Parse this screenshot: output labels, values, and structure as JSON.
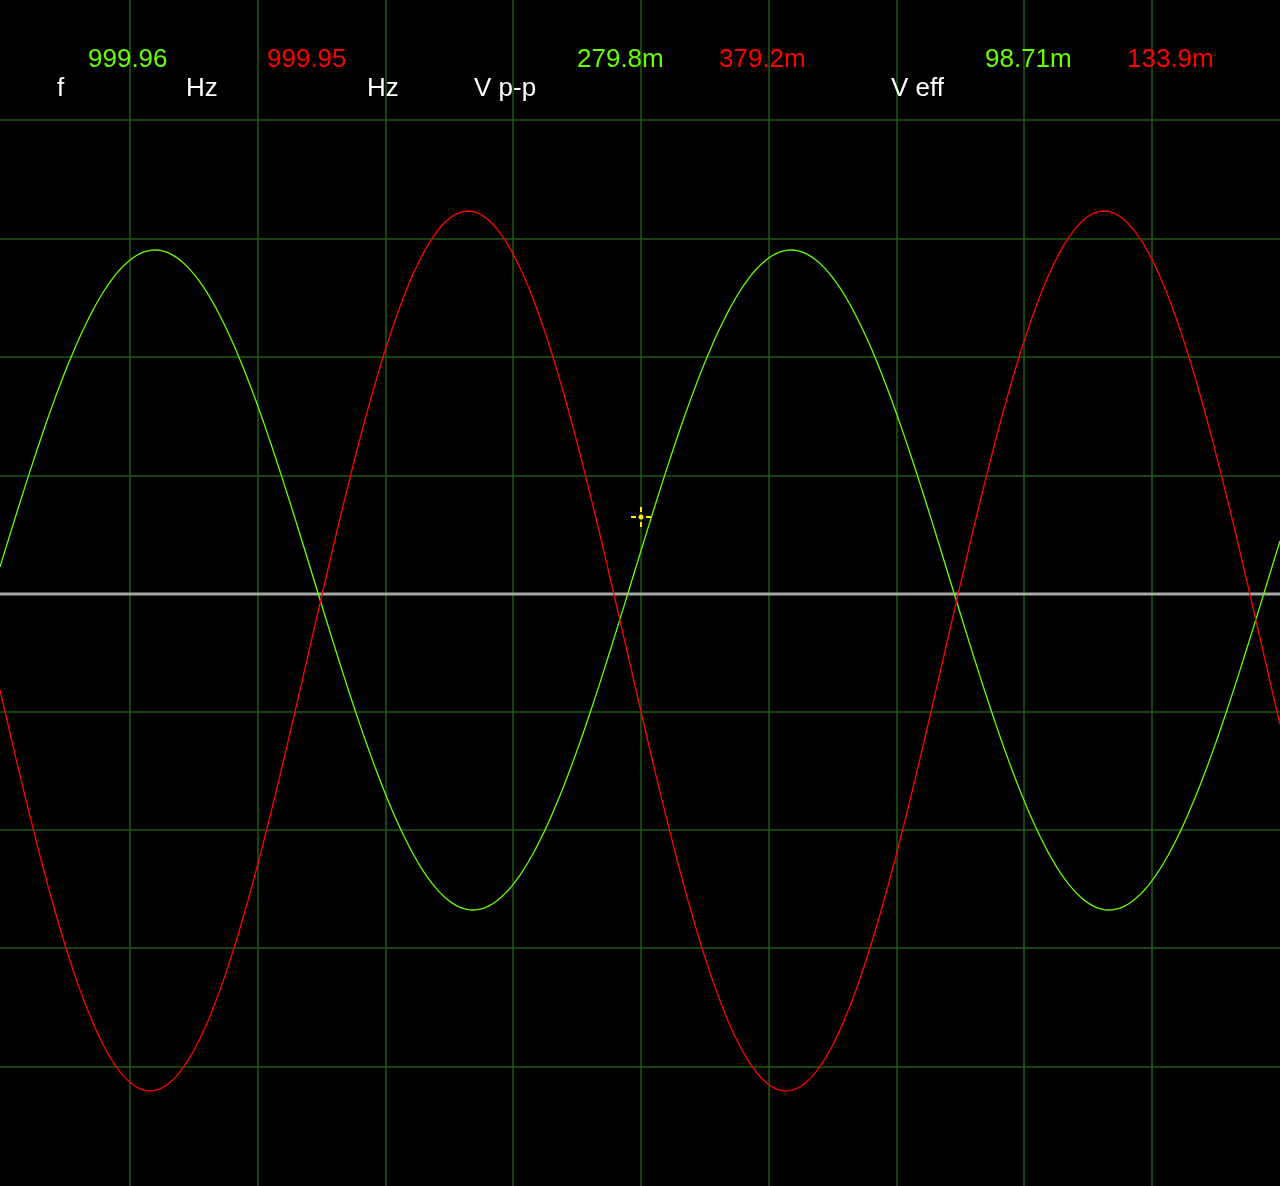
{
  "labels": {
    "frequency": "f",
    "units": [
      "Hz",
      "Hz"
    ],
    "peak_to_peak": "V p-p",
    "rms": "V eff"
  },
  "channels": [
    {
      "color": "#66ff00",
      "frequency": "999.96",
      "peak_to_peak": "279.8m",
      "rms": "98.71m"
    },
    {
      "color": "#ff0000",
      "frequency": "999.95",
      "peak_to_peak": "379.2m",
      "rms": "133.9m"
    }
  ]
}
